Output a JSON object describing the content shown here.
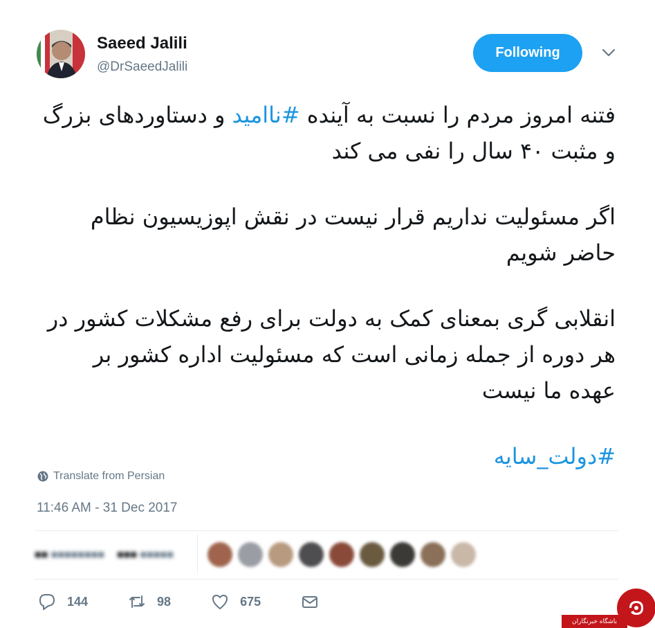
{
  "header": {
    "display_name": "Saeed Jalili",
    "handle": "@DrSaeedJalili",
    "follow_label": "Following"
  },
  "tweet": {
    "p1_before": "فتنه امروز مردم را نسبت به آینده ",
    "p1_hashtag": "#ناامید",
    "p1_after": " و دستاوردهای بزرگ و مثبت ۴۰ سال را نفی می کند",
    "p2": "اگر مسئولیت نداریم قرار نیست در نقش اپوزیسیون نظام حاضر شویم",
    "p3": "انقلابی گری بمعنای کمک به دولت برای رفع مشکلات کشور در هر دوره از جمله زمانی است که مسئولیت اداره کشور بر عهده ما نیست",
    "p4_hashtag": "#دولت_سایه"
  },
  "translate_label": "Translate from Persian",
  "timestamp": "11:46 AM - 31 Dec 2017",
  "actions": {
    "reply_count": "144",
    "retweet_count": "98",
    "like_count": "675"
  },
  "watermark": {
    "text": "باشگاه خبرنگاران"
  },
  "colors": {
    "accent": "#1da1f2",
    "hashtag": "#1b95e0",
    "muted": "#657786",
    "watermark_red": "#c2161b"
  }
}
